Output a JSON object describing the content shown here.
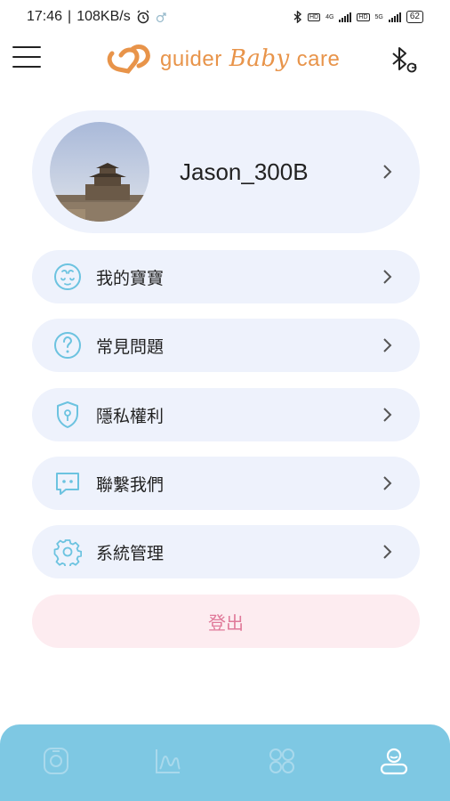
{
  "status": {
    "time": "17:46",
    "speed": "108KB/s",
    "net1": "4G",
    "net2": "5G",
    "battery": "62"
  },
  "appbar": {
    "logo_word1": "guider",
    "logo_word2": "Baby",
    "logo_word3": "care",
    "menu_icon": "hamburger-menu-icon",
    "bt_icon": "bluetooth-refresh-icon",
    "brand_color": "#e8944a"
  },
  "profile": {
    "name": "Jason_300B"
  },
  "menu": {
    "items": [
      {
        "label": "我的寶寶",
        "icon": "baby-face-icon"
      },
      {
        "label": "常見問題",
        "icon": "question-icon"
      },
      {
        "label": "隱私權利",
        "icon": "privacy-shield-icon"
      },
      {
        "label": "聯繫我們",
        "icon": "chat-icon"
      },
      {
        "label": "系統管理",
        "icon": "gear-icon"
      }
    ]
  },
  "logout": {
    "label": "登出"
  },
  "tabs": [
    {
      "icon": "device-icon"
    },
    {
      "icon": "chart-icon"
    },
    {
      "icon": "apps-icon"
    },
    {
      "icon": "profile-icon"
    }
  ],
  "colors": {
    "item_bg": "#eef2fc",
    "icon_accent": "#6cc3e0",
    "logout_bg": "#fdecf0",
    "logout_text": "#e07a9a",
    "tabbar_bg": "#7ec8e3"
  }
}
